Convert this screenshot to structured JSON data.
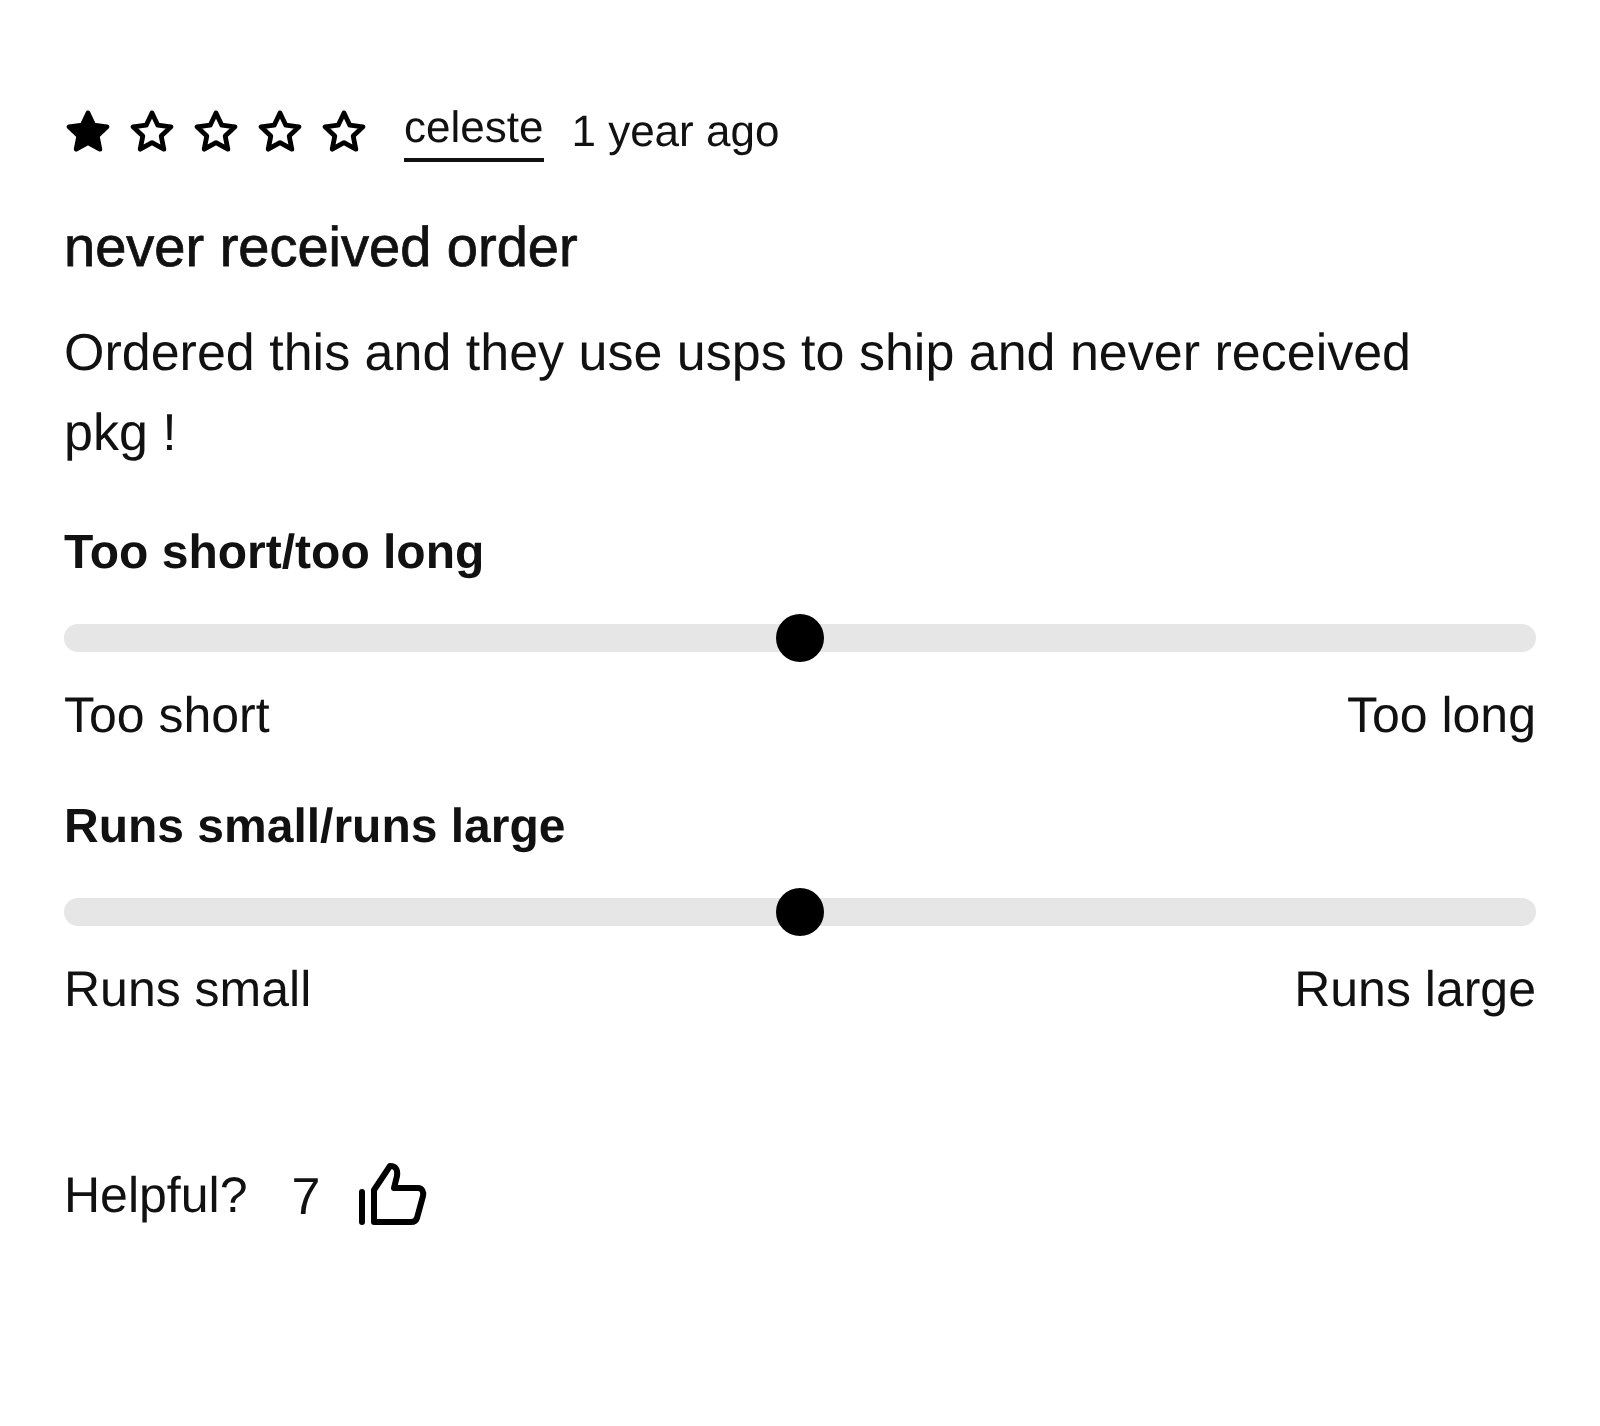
{
  "review": {
    "stars": 1,
    "author": "celeste",
    "time": "1 year ago",
    "title": "never received order",
    "body": "Ordered this and they use usps to ship and never received pkg !"
  },
  "fit": [
    {
      "heading": "Too short/too long",
      "level": 0.5,
      "min_label": "Too short",
      "max_label": "Too long"
    },
    {
      "heading": "Runs small/runs large",
      "level": 0.5,
      "min_label": "Runs small",
      "max_label": "Runs large"
    }
  ],
  "helpful": {
    "label": "Helpful?",
    "count": "7"
  }
}
